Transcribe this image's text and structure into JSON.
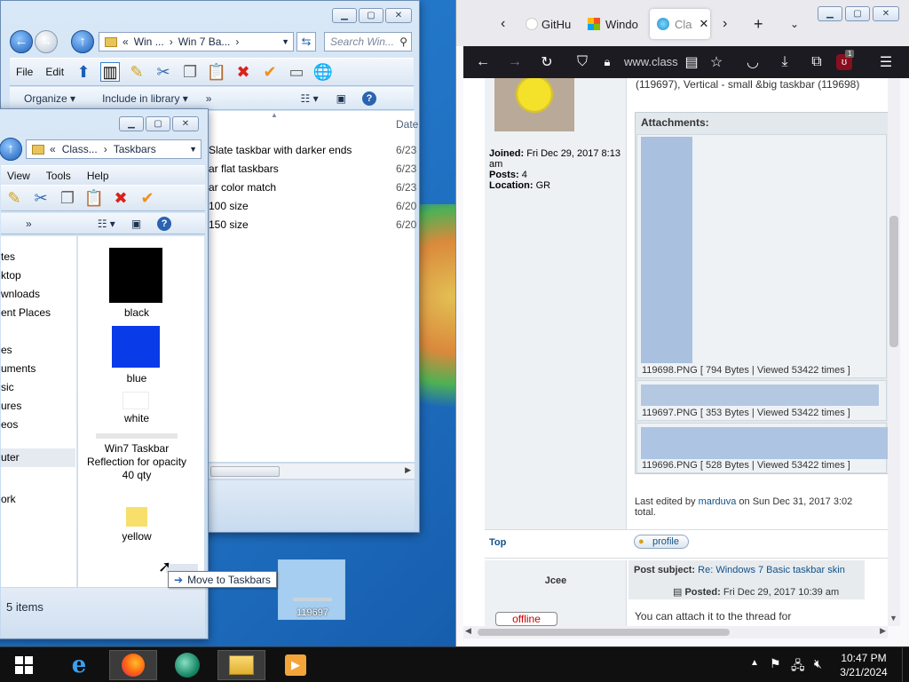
{
  "desktop": {
    "drag_icon_label": "119697",
    "drag_tooltip": "Move to Taskbars"
  },
  "explorer_back": {
    "breadcrumb": [
      "«",
      "Win ...",
      "›",
      "Win 7 Ba...",
      "›"
    ],
    "search_placeholder": "Search Win...",
    "menu": [
      "File",
      "Edit"
    ],
    "cmd": {
      "organize": "Organize",
      "include": "Include in library",
      "more": "»"
    },
    "col_date": "Date",
    "files": [
      {
        "name": "Slate taskbar with darker ends",
        "date": "6/23"
      },
      {
        "name": "ar flat taskbars",
        "date": "6/23"
      },
      {
        "name": "ar color match",
        "date": "6/23"
      },
      {
        "name": "100 size",
        "date": "6/20"
      },
      {
        "name": "150 size",
        "date": "6/20"
      }
    ]
  },
  "explorer_front": {
    "breadcrumb": [
      "«",
      "Class...",
      "›",
      "Taskbars"
    ],
    "menu": [
      "View",
      "Tools",
      "Help"
    ],
    "more": "»",
    "nav": [
      "tes",
      "ktop",
      "wnloads",
      "ent Places",
      "es",
      "uments",
      "sic",
      "ures",
      "eos",
      "uter",
      "ork"
    ],
    "items": [
      {
        "label": "black",
        "color": "#000000"
      },
      {
        "label": "blue",
        "color": "#0a3be8"
      },
      {
        "label": "white",
        "color": "#ffffff"
      },
      {
        "label": "Win7 Taskbar Reflection for opacity 40 qty",
        "color": "#e6e6e6"
      },
      {
        "label": "yellow",
        "color": "#f8df6b"
      }
    ],
    "status": "5 items"
  },
  "browser": {
    "tabs": [
      {
        "label": "GitHu"
      },
      {
        "label": "Windo"
      },
      {
        "label": "Cla"
      }
    ],
    "url": "www.class",
    "ublock_count": "1",
    "post1": {
      "title_snippet": "(119697), Vertical - small &big taskbar (119698)",
      "joined_label": "Joined:",
      "joined": "Fri Dec 29, 2017 8:13 am",
      "posts_label": "Posts:",
      "posts": "4",
      "location_label": "Location:",
      "location": "GR",
      "attachments_title": "Attachments:",
      "attachments": [
        {
          "caption": "119698.PNG [ 794 Bytes | Viewed 53422 times ]"
        },
        {
          "caption": "119697.PNG [ 353 Bytes | Viewed 53422 times ]"
        },
        {
          "caption": "119696.PNG [ 528 Bytes | Viewed 53422 times ]"
        }
      ],
      "edited_prefix": "Last edited by",
      "edited_user": "marduva",
      "edited_suffix": "on Sun Dec 31, 2017 3:02",
      "edited_total": "total.",
      "top_link": "Top",
      "profile_btn": "profile"
    },
    "post2": {
      "author": "Jcee",
      "subject_label": "Post subject:",
      "subject": "Re: Windows 7 Basic taskbar skin",
      "posted_label": "Posted:",
      "posted": "Fri Dec 29, 2017 10:39 am",
      "status_btn": "offline",
      "body": "You can attach it to the thread for"
    }
  },
  "taskbar": {
    "time": "10:47 PM",
    "date": "3/21/2024"
  }
}
